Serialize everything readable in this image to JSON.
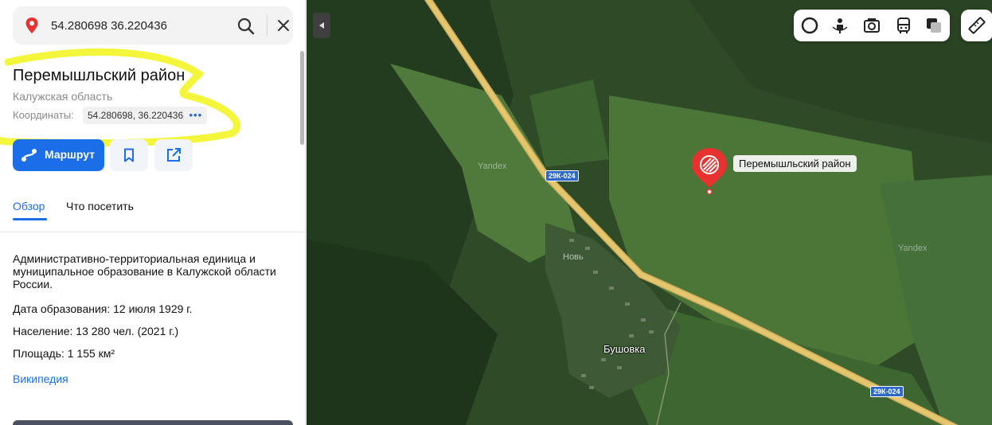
{
  "search": {
    "value": "54.280698 36.220436"
  },
  "place": {
    "title": "Перемышльский район",
    "region": "Калужская область",
    "coords_label": "Координаты:",
    "coords_value": "54.280698, 36.220436",
    "coords_more": "•••"
  },
  "actions": {
    "route_label": "Маршрут"
  },
  "tabs": [
    {
      "label": "Обзор",
      "active": true
    },
    {
      "label": "Что посетить",
      "active": false
    }
  ],
  "overview": {
    "description": "Административно-территориальная единица и муниципальное образование в Калужской области России.",
    "facts": [
      {
        "key": "Дата образования:",
        "value": "12 июля 1929 г."
      },
      {
        "key": "Население:",
        "value": "13 280 чел. (2021 г.)"
      },
      {
        "key": "Площадь:",
        "value": "1 155 км²"
      }
    ],
    "wiki_link": "Википедия"
  },
  "map": {
    "road_labels": [
      "29К-024",
      "29К-024"
    ],
    "watermarks": [
      "Yandex",
      "Yandex"
    ],
    "villages": [
      "Новь",
      "Бушовка"
    ],
    "poi_label": "Перемышльский район",
    "layer_icons": [
      "panorama-icon",
      "street-view-icon",
      "photo-icon",
      "transit-icon",
      "layers-icon"
    ],
    "ruler_icon": "ruler-icon"
  },
  "colors": {
    "accent": "#1c6ee8",
    "poi_red": "#e8322f",
    "road": "#e3c66e",
    "highlight": "#f3f526"
  }
}
